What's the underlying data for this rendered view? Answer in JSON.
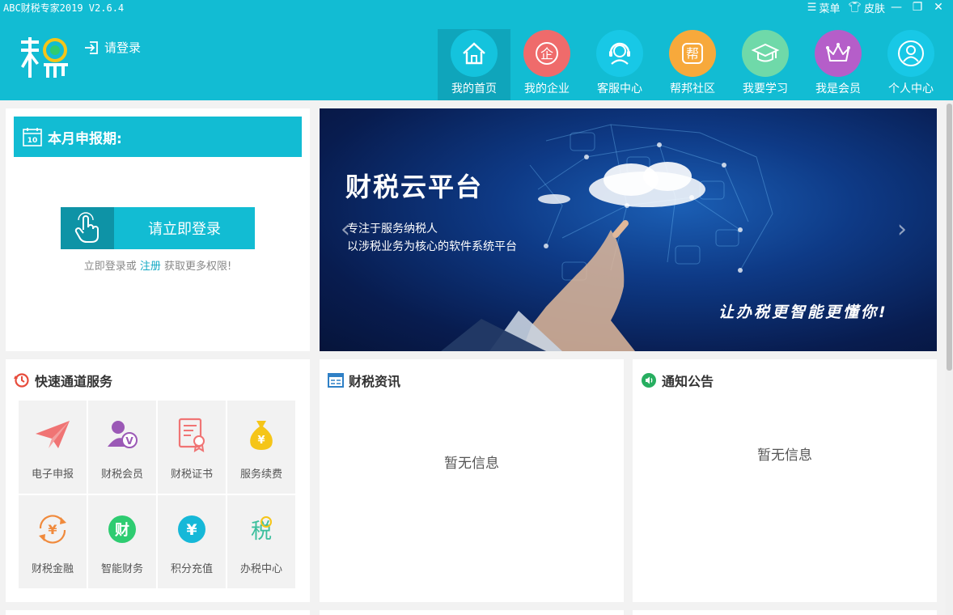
{
  "window": {
    "title": "ABC财税专家2019 V2.6.4",
    "menu_label": "菜单",
    "skin_label": "皮肤"
  },
  "header": {
    "login_label": "请登录",
    "brand_color": "#12bcd3",
    "nav": [
      {
        "label": "我的首页",
        "icon": "home-icon",
        "color": "#14c3dd",
        "active": true
      },
      {
        "label": "我的企业",
        "icon": "enterprise-icon",
        "color": "#ef6b6b",
        "glyph": "企"
      },
      {
        "label": "客服中心",
        "icon": "headset-icon",
        "color": "#18c8e6"
      },
      {
        "label": "帮邦社区",
        "icon": "community-icon",
        "color": "#f7a93b",
        "glyph": "帮"
      },
      {
        "label": "我要学习",
        "icon": "graduation-cap-icon",
        "color": "#6fd9a9"
      },
      {
        "label": "我是会员",
        "icon": "crown-icon",
        "color": "#b55ec9"
      },
      {
        "label": "个人中心",
        "icon": "user-icon",
        "color": "#18c8e6"
      }
    ]
  },
  "declaration": {
    "title": "本月申报期:",
    "calendar_day": "10",
    "login_button": "请立即登录",
    "hint_prefix": "立即登录或",
    "hint_link": "注册",
    "hint_suffix": "获取更多权限!"
  },
  "banner": {
    "title": "财税云平台",
    "line1": "专注于服务纳税人",
    "line2": "以涉税业务为核心的软件系统平台",
    "slogan": "让办税更智能更懂你!"
  },
  "quick_services": {
    "title": "快速通道服务",
    "items": [
      {
        "label": "电子申报",
        "icon": "paper-plane-icon",
        "color": "#f07474"
      },
      {
        "label": "财税会员",
        "icon": "member-v-icon",
        "color": "#9b59b6"
      },
      {
        "label": "财税证书",
        "icon": "certificate-icon",
        "color": "#f07474"
      },
      {
        "label": "服务续费",
        "icon": "money-bag-icon",
        "color": "#f5c518",
        "glyph": "¥"
      },
      {
        "label": "财税金融",
        "icon": "yuan-exchange-icon",
        "color": "#f08a3c",
        "glyph": "¥"
      },
      {
        "label": "智能财务",
        "icon": "finance-icon",
        "color": "#2ecc71",
        "glyph": "财"
      },
      {
        "label": "积分充值",
        "icon": "yuan-icon",
        "color": "#16b8d8",
        "glyph": "¥"
      },
      {
        "label": "办税中心",
        "icon": "tax-center-icon",
        "color": "#3bbf9d",
        "glyph": "税"
      }
    ]
  },
  "news": {
    "title": "财税资讯",
    "empty": "暂无信息"
  },
  "notice": {
    "title": "通知公告",
    "empty": "暂无信息"
  }
}
